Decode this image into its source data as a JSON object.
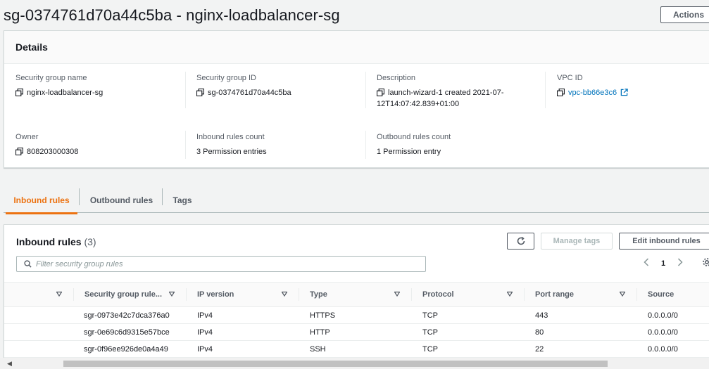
{
  "header": {
    "title": "sg-0374761d70a44c5ba - nginx-loadbalancer-sg",
    "actions_label": "Actions"
  },
  "details": {
    "heading": "Details",
    "fields": {
      "sg_name": {
        "label": "Security group name",
        "value": "nginx-loadbalancer-sg"
      },
      "sg_id": {
        "label": "Security group ID",
        "value": "sg-0374761d70a44c5ba"
      },
      "description": {
        "label": "Description",
        "value_line1": "launch-wizard-1 created 2021-07-",
        "value_line2": "12T14:07:42.839+01:00"
      },
      "vpc_id": {
        "label": "VPC ID",
        "value": "vpc-bb66e3c6"
      },
      "owner": {
        "label": "Owner",
        "value": "808203000308"
      },
      "inbound_count": {
        "label": "Inbound rules count",
        "value": "3 Permission entries"
      },
      "outbound_count": {
        "label": "Outbound rules count",
        "value": "1 Permission entry"
      }
    }
  },
  "tabs": [
    {
      "label": "Inbound rules",
      "active": true
    },
    {
      "label": "Outbound rules",
      "active": false
    },
    {
      "label": "Tags",
      "active": false
    }
  ],
  "inbound": {
    "title": "Inbound rules",
    "count": "(3)",
    "manage_tags_label": "Manage tags",
    "edit_label": "Edit inbound rules",
    "filter_placeholder": "Filter security group rules",
    "page": "1",
    "columns": [
      "Security group rule...",
      "IP version",
      "Type",
      "Protocol",
      "Port range",
      "Source"
    ],
    "rows": [
      {
        "rule_id": "sgr-0973e42c7dca376a0",
        "ip_version": "IPv4",
        "type": "HTTPS",
        "protocol": "TCP",
        "port_range": "443",
        "source": "0.0.0.0/0"
      },
      {
        "rule_id": "sgr-0e69c6d9315e57bce",
        "ip_version": "IPv4",
        "type": "HTTP",
        "protocol": "TCP",
        "port_range": "80",
        "source": "0.0.0.0/0"
      },
      {
        "rule_id": "sgr-0f96ee926de0a4a49",
        "ip_version": "IPv4",
        "type": "SSH",
        "protocol": "TCP",
        "port_range": "22",
        "source": "0.0.0.0/0"
      }
    ]
  },
  "colors": {
    "accent": "#ec7211",
    "link": "#0073bb",
    "text": "#16191f",
    "muted": "#545b64"
  }
}
